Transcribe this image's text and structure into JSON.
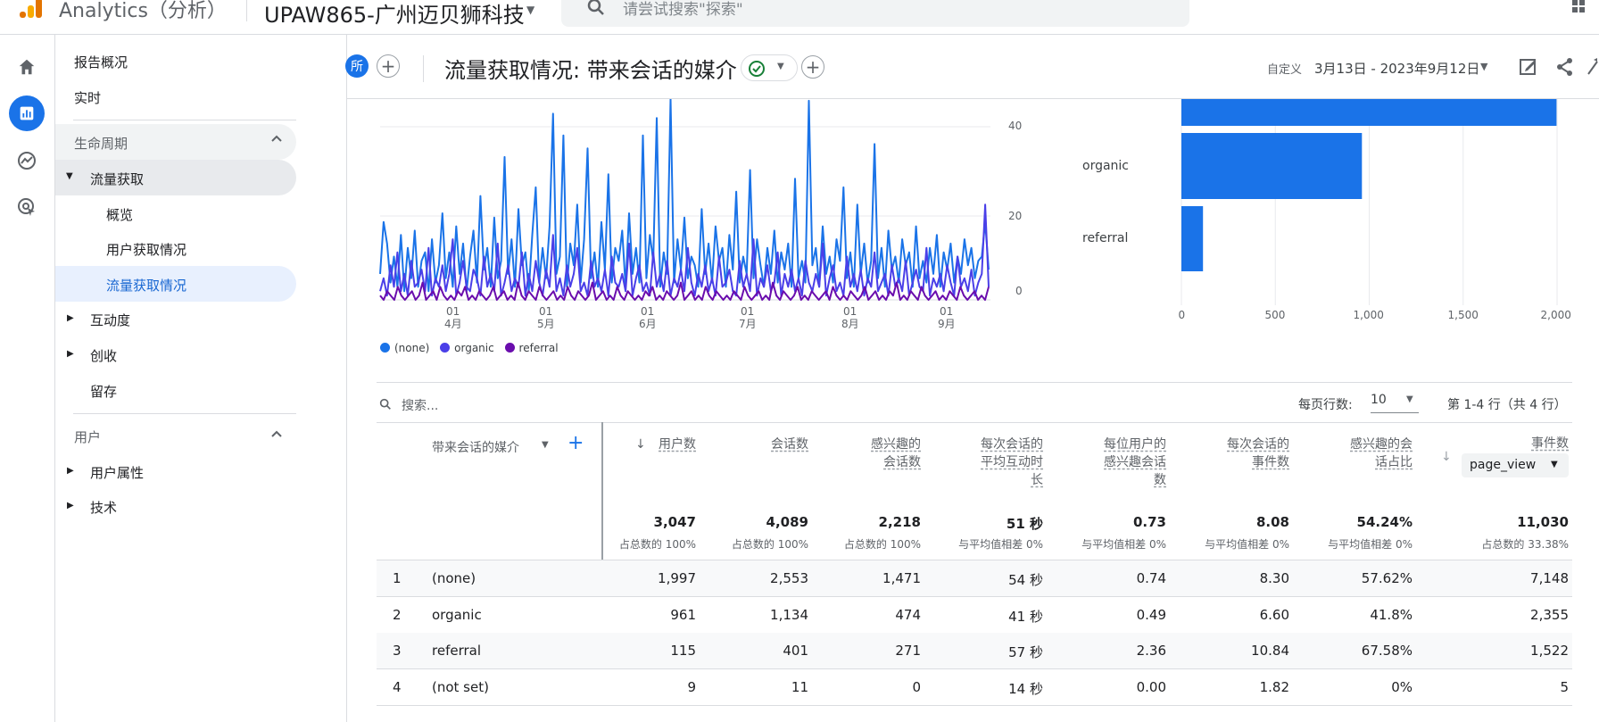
{
  "topbar": {
    "app_name": "Analytics（分析）",
    "property": "UPAW865-广州迈贝狮科技",
    "search_placeholder": "请尝试搜索\"探索\""
  },
  "nav": {
    "reports_overview": "报告概况",
    "realtime": "实时",
    "section_lifecycle": "生命周期",
    "traffic_acquisition": "流量获取",
    "overview": "概览",
    "user_acquisition": "用户获取情况",
    "traffic_acquisition_report": "流量获取情况",
    "engagement": "互动度",
    "monetization": "创收",
    "retention": "留存",
    "section_user": "用户",
    "user_attributes": "用户属性",
    "tech": "技术"
  },
  "header": {
    "badge": "所",
    "title": "流量获取情况: 带来会话的媒介",
    "date_prefix": "自定义",
    "date_range": "3月13日 - 2023年9月12日"
  },
  "colors": {
    "none": "#1a73e8",
    "organic": "#4a3fe8",
    "referral": "#6a0dad",
    "accent": "#1a73e8"
  },
  "chart_data": [
    {
      "type": "line",
      "x_ticks": [
        {
          "day": "01",
          "month": "4月"
        },
        {
          "day": "01",
          "month": "5月"
        },
        {
          "day": "01",
          "month": "6月"
        },
        {
          "day": "01",
          "month": "7月"
        },
        {
          "day": "01",
          "month": "8月"
        },
        {
          "day": "01",
          "month": "9月"
        }
      ],
      "y_ticks": [
        "0",
        "20",
        "40"
      ],
      "ylim": [
        0,
        40
      ],
      "series": [
        {
          "name": "(none)",
          "values": [
            6,
            18,
            13,
            4,
            10,
            3,
            15,
            2,
            12,
            5,
            16,
            3,
            9,
            11,
            2,
            14,
            4,
            8,
            20,
            5,
            11,
            3,
            17,
            6,
            13,
            2,
            10,
            16,
            4,
            24,
            7,
            12,
            3,
            19,
            5,
            9,
            33,
            6,
            14,
            3,
            21,
            8,
            11,
            2,
            15,
            26,
            4,
            12,
            5,
            17,
            43,
            6,
            10,
            38,
            3,
            13,
            8,
            22,
            4,
            14,
            35,
            5,
            11,
            3,
            18,
            7,
            29,
            4,
            12,
            9,
            16,
            3,
            20,
            6,
            12,
            4,
            38,
            5,
            15,
            9,
            42,
            3,
            11,
            6,
            48,
            4,
            14,
            7,
            19,
            5,
            10,
            8,
            3,
            21,
            6,
            13,
            4,
            17,
            9,
            12,
            3,
            15,
            7,
            25,
            4,
            10,
            6,
            30,
            5,
            14,
            8,
            3,
            12,
            6,
            16,
            4,
            11,
            7,
            13,
            3,
            28,
            5,
            9,
            4,
            46,
            8,
            12,
            3,
            17,
            6,
            10,
            4,
            14,
            9,
            26,
            5,
            11,
            3,
            22,
            6,
            13,
            4,
            9,
            36,
            5,
            12,
            3,
            16,
            7,
            10,
            4,
            14,
            8,
            11,
            3,
            17,
            5,
            9,
            4,
            12,
            6,
            15,
            3,
            11,
            7,
            13,
            4,
            10,
            6,
            14,
            8,
            12,
            5,
            9,
            10,
            18,
            7
          ]
        },
        {
          "name": "organic",
          "values": [
            2,
            5,
            1,
            8,
            3,
            11,
            2,
            6,
            1,
            9,
            3,
            4,
            7,
            2,
            12,
            1,
            5,
            3,
            8,
            2,
            6,
            14,
            1,
            4,
            9,
            3,
            2,
            7,
            5,
            1,
            10,
            3,
            6,
            2,
            13,
            1,
            4,
            8,
            2,
            5,
            3,
            11,
            1,
            6,
            2,
            9,
            4,
            1,
            7,
            3,
            15,
            2,
            5,
            1,
            8,
            3,
            6,
            12,
            2,
            4,
            1,
            9,
            3,
            5,
            2,
            7,
            1,
            10,
            4,
            3,
            6,
            2,
            13,
            1,
            5,
            8,
            2,
            4,
            1,
            11,
            3,
            6,
            2,
            9,
            1,
            5,
            3,
            7,
            2,
            12,
            4,
            1,
            6,
            3,
            8,
            2,
            5,
            1,
            10,
            3,
            4,
            7,
            2,
            1,
            9,
            3,
            6,
            2,
            14,
            1,
            5,
            3,
            8,
            2,
            4,
            11,
            1,
            6,
            3,
            7,
            2,
            5,
            1,
            9,
            4,
            2,
            6,
            3,
            13,
            1,
            5,
            8,
            2,
            4,
            1,
            10,
            3,
            6,
            2,
            7,
            1,
            5,
            3,
            11,
            2,
            4,
            6,
            1,
            8,
            3,
            5,
            2,
            9,
            1,
            4,
            7,
            3,
            2,
            12,
            1,
            5,
            3,
            6,
            2,
            8,
            4,
            1,
            10,
            3,
            5,
            2,
            7,
            1,
            4,
            6,
            22,
            3
          ]
        },
        {
          "name": "referral",
          "values": [
            1,
            0,
            2,
            1,
            0,
            3,
            1,
            0,
            1,
            2,
            0,
            1,
            4,
            0,
            1,
            2,
            0,
            3,
            1,
            0,
            1,
            0,
            2,
            1,
            3,
            0,
            1,
            0,
            2,
            1,
            0,
            1,
            3,
            0,
            1,
            2,
            0,
            1,
            0,
            4,
            1,
            0,
            2,
            1,
            0,
            3,
            1,
            0,
            1,
            2,
            0,
            1,
            0,
            3,
            1,
            0,
            2,
            1,
            0,
            1,
            4,
            0,
            1,
            2,
            0,
            1,
            0,
            3,
            1,
            0,
            2,
            1,
            0,
            1,
            0,
            2,
            1,
            3,
            0,
            1,
            0,
            2,
            1,
            0,
            1,
            4,
            0,
            1,
            2,
            0,
            1,
            0,
            3,
            1,
            0,
            2,
            1,
            0,
            1,
            0,
            2,
            1,
            0,
            3,
            1,
            0,
            1,
            2,
            0,
            1,
            0,
            4,
            1,
            0,
            2,
            1,
            0,
            1,
            3,
            0,
            1,
            0,
            2,
            1,
            0,
            1,
            2,
            0,
            3,
            1,
            0,
            1,
            0,
            2,
            1,
            0,
            1,
            3,
            0,
            1,
            2,
            0,
            1,
            0,
            2,
            1,
            4,
            0,
            1,
            0,
            2,
            1,
            0,
            3,
            1,
            0,
            1,
            2,
            0,
            1,
            0,
            2,
            1,
            0,
            3,
            1,
            0,
            1,
            2,
            0,
            1,
            0,
            3
          ]
        }
      ]
    },
    {
      "type": "bar",
      "orientation": "horizontal",
      "categories": [
        "(none)",
        "organic",
        "referral"
      ],
      "values": [
        1997,
        961,
        115
      ],
      "x_ticks": [
        "0",
        "500",
        "1,000",
        "1,500",
        "2,000"
      ],
      "xlim": [
        0,
        2000
      ]
    }
  ],
  "table": {
    "search_placeholder": "搜索...",
    "rows_per_page_label": "每页行数:",
    "rows_per_page_value": "10",
    "pager": "第 1-4 行（共 4 行）",
    "dim_header": "带来会话的媒介",
    "headers": [
      [
        "用户数"
      ],
      [
        "会话数"
      ],
      [
        "感兴趣的",
        "会话数"
      ],
      [
        "每次会话的",
        "平均互动时",
        "长"
      ],
      [
        "每位用户的",
        "感兴趣会话",
        "数"
      ],
      [
        "每次会话的",
        "事件数"
      ],
      [
        "感兴趣的会",
        "话占比"
      ],
      [
        "事件数"
      ]
    ],
    "event_chip": "page_view",
    "totals": [
      "3,047",
      "4,089",
      "2,218",
      "51 秒",
      "0.73",
      "8.08",
      "54.24%",
      "11,030"
    ],
    "totals_sub": [
      "占总数的 100%",
      "占总数的 100%",
      "占总数的 100%",
      "与平均值相差 0%",
      "与平均值相差 0%",
      "与平均值相差 0%",
      "与平均值相差 0%",
      "占总数的 33.38%"
    ],
    "rows": [
      {
        "num": "1",
        "dim": "(none)",
        "values": [
          "1,997",
          "2,553",
          "1,471",
          "54 秒",
          "0.74",
          "8.30",
          "57.62%",
          "7,148"
        ]
      },
      {
        "num": "2",
        "dim": "organic",
        "values": [
          "961",
          "1,134",
          "474",
          "41 秒",
          "0.49",
          "6.60",
          "41.8%",
          "2,355"
        ]
      },
      {
        "num": "3",
        "dim": "referral",
        "values": [
          "115",
          "401",
          "271",
          "57 秒",
          "2.36",
          "10.84",
          "67.58%",
          "1,522"
        ]
      },
      {
        "num": "4",
        "dim": "(not set)",
        "values": [
          "9",
          "11",
          "0",
          "14 秒",
          "0.00",
          "1.82",
          "0%",
          "5"
        ]
      }
    ]
  }
}
